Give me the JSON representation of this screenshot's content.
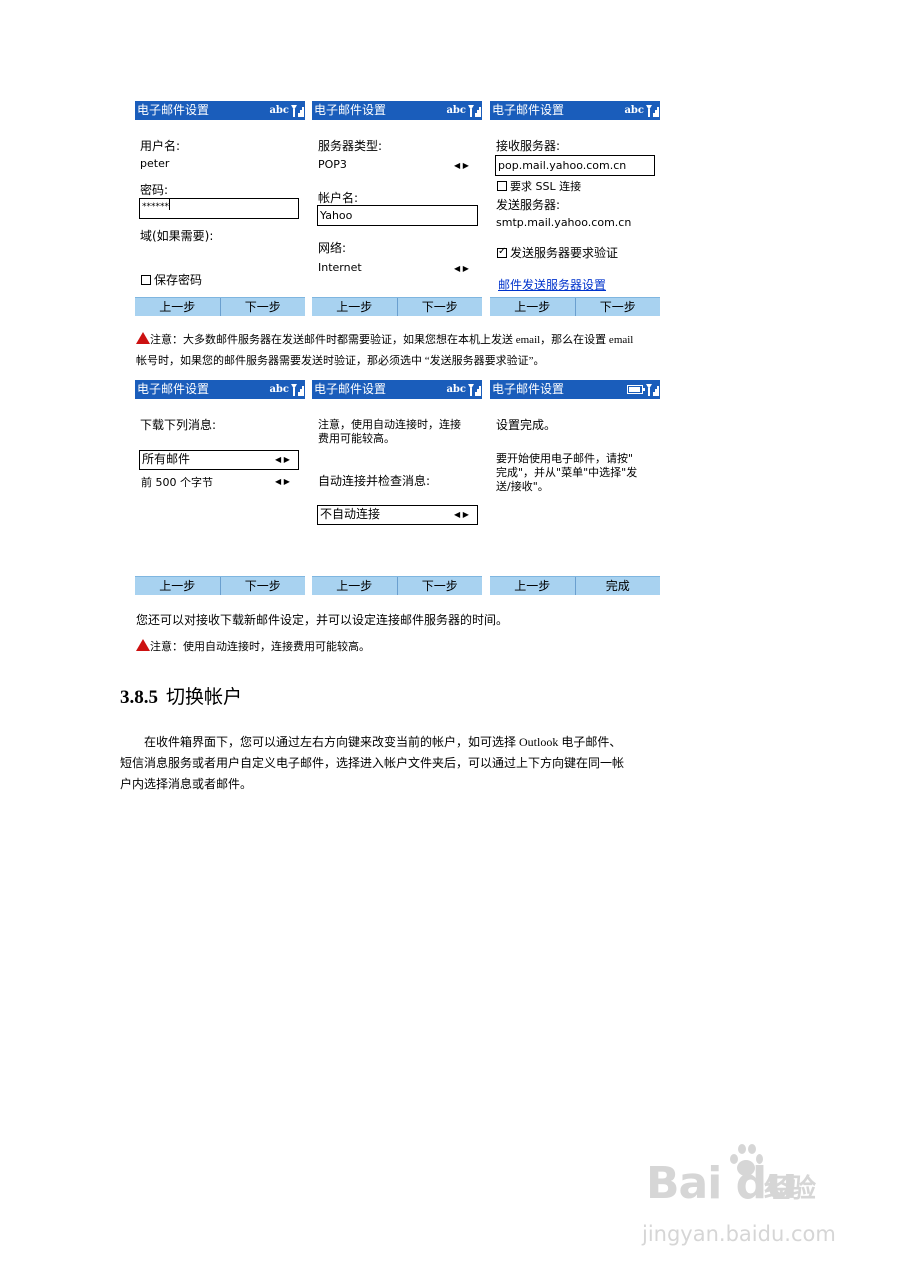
{
  "status": {
    "abc": "abc"
  },
  "row1": {
    "s1": {
      "title": "电子邮件设置",
      "user_label": "用户名:",
      "user_value": "peter",
      "pwd_label": "密码:",
      "pwd_value": "******",
      "domain_label": "域(如果需要):",
      "save_pwd": "保存密码",
      "left": "上一步",
      "right": "下一步"
    },
    "s2": {
      "title": "电子邮件设置",
      "server_type_label": "服务器类型:",
      "server_type_value": "POP3",
      "account_label": "帐户名:",
      "account_value": "Yahoo",
      "network_label": "网络:",
      "network_value": "Internet",
      "left": "上一步",
      "right": "下一步"
    },
    "s3": {
      "title": "电子邮件设置",
      "in_label": "接收服务器:",
      "in_value": "pop.mail.yahoo.com.cn",
      "ssl": "要求 SSL 连接",
      "out_label": "发送服务器:",
      "out_value": "smtp.mail.yahoo.com.cn",
      "auth": "发送服务器要求验证",
      "link": "邮件发送服务器设置",
      "left": "上一步",
      "right": "下一步"
    }
  },
  "note1": {
    "line1": "注意：大多数邮件服务器在发送邮件时都需要验证，如果您想在本机上发送 email，那么在设置 email",
    "line2": "帐号时，如果您的邮件服务器需要发送时验证，那必须选中 “发送服务器要求验证”。"
  },
  "row2": {
    "s1": {
      "title": "电子邮件设置",
      "label": "下载下列消息:",
      "opt1": "所有邮件",
      "opt2": "前 500 个字节",
      "left": "上一步",
      "right": "下一步"
    },
    "s2": {
      "title": "电子邮件设置",
      "note1": "注意，使用自动连接时，连接",
      "note2": "费用可能较高。",
      "label": "自动连接并检查消息:",
      "opt": "不自动连接",
      "left": "上一步",
      "right": "下一步"
    },
    "s3": {
      "title": "电子邮件设置",
      "done": "设置完成。",
      "l1": "要开始使用电子邮件，请按\"",
      "l2": "完成\"，并从\"菜单\"中选择\"发",
      "l3": "送/接收\"。",
      "left": "上一步",
      "right": "完成"
    }
  },
  "text_after": "您还可以对接收下载新邮件设定，并可以设定连接邮件服务器的时间。",
  "note2": "注意：使用自动连接时，连接费用可能较高。",
  "heading": {
    "num": "3.8.5",
    "title": "切换帐户"
  },
  "paragraph": {
    "l1": "在收件箱界面下，您可以通过左右方向键来改变当前的帐户，如可选择 Outlook 电子邮件、",
    "l2": "短信消息服务或者用户自定义电子邮件，选择进入帐户文件夹后，可以通过上下方向键在同一帐",
    "l3": "户内选择消息或者邮件。"
  },
  "watermark": {
    "brand": "Bai du",
    "cn": "经验",
    "url": "jingyan.baidu.com"
  },
  "colors": {
    "titlebar": "#1a5dbb",
    "softkeys": "#a8d2f0",
    "warning": "#cc1111",
    "link": "#0033cc"
  }
}
